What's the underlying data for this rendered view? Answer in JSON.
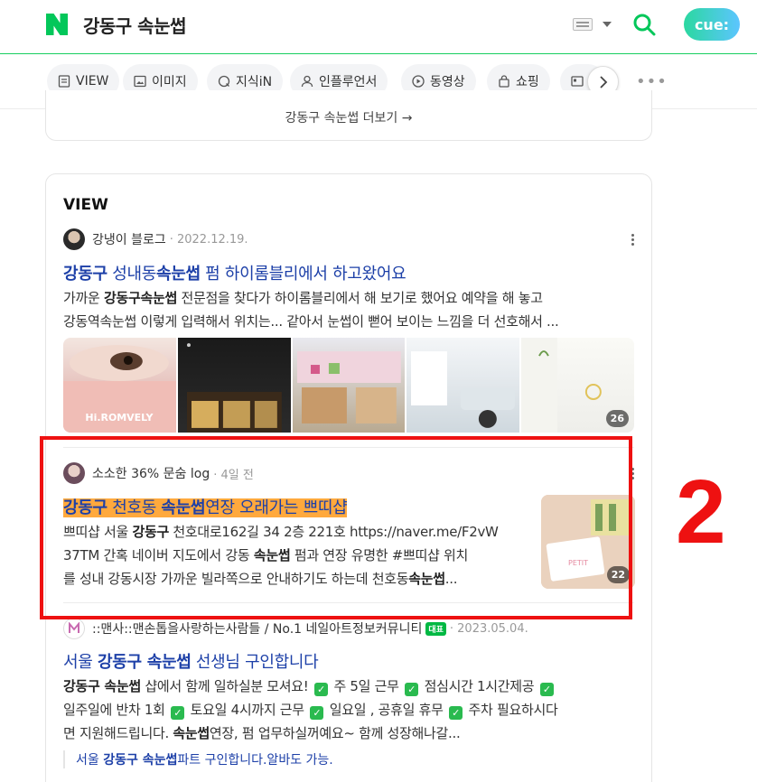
{
  "header": {
    "query": "강동구 속눈썹",
    "cue_label": "cue:"
  },
  "tabs": [
    {
      "label": "VIEW",
      "icon": "document-icon"
    },
    {
      "label": "이미지",
      "icon": "image-icon"
    },
    {
      "label": "지식iN",
      "icon": "qna-icon"
    },
    {
      "label": "인플루언서",
      "icon": "person-icon"
    },
    {
      "label": "동영상",
      "icon": "play-icon"
    },
    {
      "label": "쇼핑",
      "icon": "bag-icon"
    }
  ],
  "more_link": "강동구 속눈썹 더보기 →",
  "view": {
    "title": "VIEW",
    "posts": [
      {
        "source": "강냉이 블로그",
        "date": "· 2022.12.19.",
        "title": [
          {
            "t": "강동구",
            "b": true
          },
          {
            "t": " 성내동",
            "b": false
          },
          {
            "t": "속눈썹",
            "b": true
          },
          {
            "t": " 펌 하이롬블리에서 하고왔어요",
            "b": false
          }
        ],
        "desc_line1": [
          {
            "t": "가까운 ",
            "b": false
          },
          {
            "t": "강동구속눈썹",
            "b": true
          },
          {
            "t": " 전문점을 찾다가 하이롬블리에서 해 보기로 했어요 예약을 해 놓고",
            "b": false
          }
        ],
        "desc_line2": "강동역속눈썹 이렇게 입력해서 위치는... 같아서 눈썹이 뻗어 보이는 느낌을 더 선호해서 ...",
        "image_count": "26",
        "thumb_text": "Hi.ROMVELY"
      },
      {
        "source": "소소한 36% 문숨 log",
        "date": "· 4일 전",
        "title": [
          {
            "t": "강동구",
            "b": true
          },
          {
            "t": " 천호동 ",
            "b": false
          },
          {
            "t": "속눈썹",
            "b": true
          },
          {
            "t": "연장 오래가는 쁘띠샵",
            "b": false
          }
        ],
        "desc_line1": [
          {
            "t": "쁘띠샵 서울 ",
            "b": false
          },
          {
            "t": "강동구",
            "b": true
          },
          {
            "t": " 천호대로162길 34 2층 221호 https://naver.me/F2vW",
            "b": false
          }
        ],
        "desc_line2": [
          {
            "t": "37TM 간혹 네이버 지도에서 강동 ",
            "b": false
          },
          {
            "t": "속눈썹",
            "b": true
          },
          {
            "t": " 펌과 연장 유명한 #쁘띠샵 위치",
            "b": false
          }
        ],
        "desc_line3": [
          {
            "t": "를 성내 강동시장 가까운 빌라쪽으로 안내하기도 하는데 천호동",
            "b": false
          },
          {
            "t": "속눈썹",
            "b": true
          },
          {
            "t": "...",
            "b": false
          }
        ],
        "image_count": "22",
        "thumb_text": "PETIT"
      },
      {
        "source": "::맨사::맨손톱을사랑하는사람들 / No.1 네일아트정보커뮤니티",
        "badge": "대표",
        "date": "· 2023.05.04.",
        "title": [
          {
            "t": "서울 ",
            "b": false
          },
          {
            "t": "강동구 속눈썹",
            "b": true
          },
          {
            "t": " 선생님 구인합니다",
            "b": false
          }
        ],
        "desc_line1": [
          {
            "t": "강동구 속눈썹",
            "b": true
          },
          {
            "t": " 샵에서 함께 일하실분 모셔요! ",
            "b": false
          },
          {
            "t": "✓",
            "c": true
          },
          {
            "t": " 주 5일 근무 ",
            "b": false
          },
          {
            "t": "✓",
            "c": true
          },
          {
            "t": " 점심시간 1시간제공 ",
            "b": false
          },
          {
            "t": "✓",
            "c": true
          }
        ],
        "desc_line2": [
          {
            "t": "일주일에 반차 1회 ",
            "b": false
          },
          {
            "t": "✓",
            "c": true
          },
          {
            "t": " 토요일 4시까지 근무 ",
            "b": false
          },
          {
            "t": "✓",
            "c": true
          },
          {
            "t": " 일요일 , 공휴일 휴무 ",
            "b": false
          },
          {
            "t": "✓",
            "c": true
          },
          {
            "t": " 주차 필요하시다",
            "b": false
          }
        ],
        "desc_line3": [
          {
            "t": "면 지원해드립니다. ",
            "b": false
          },
          {
            "t": "속눈썹",
            "b": true
          },
          {
            "t": "연장, 펌 업무하실꺼예요~ 함께 성장해나갈...",
            "b": false
          }
        ],
        "sub_link": [
          {
            "t": "서울 ",
            "b": false
          },
          {
            "t": "강동구 속눈썹",
            "b": true
          },
          {
            "t": "파트 구인합니다.알바도 가능.",
            "b": false
          }
        ]
      }
    ]
  },
  "annotation": {
    "number": "2",
    "color": "#ee1111"
  },
  "colors": {
    "naver_green": "#03c75a",
    "link_blue": "#1d40a8",
    "highlight": "#ffa93d"
  }
}
